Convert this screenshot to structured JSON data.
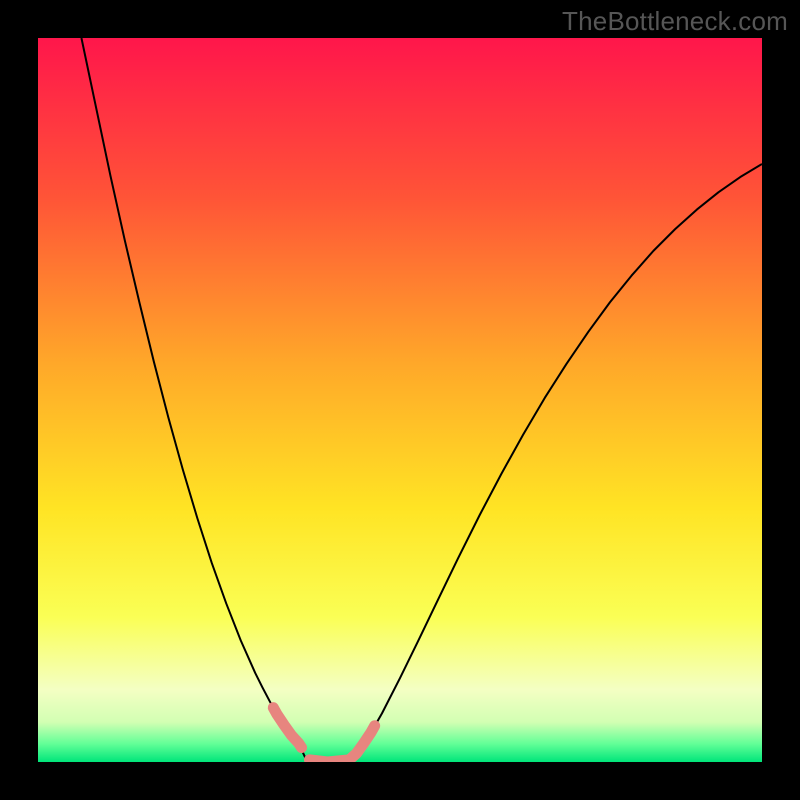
{
  "watermark": "TheBottleneck.com",
  "chart_data": {
    "type": "line",
    "title": "",
    "xlabel": "",
    "ylabel": "",
    "xlim": [
      0,
      100
    ],
    "ylim": [
      0,
      100
    ],
    "gradient_stops": [
      {
        "offset": 0,
        "color": "#ff164b"
      },
      {
        "offset": 0.22,
        "color": "#ff5437"
      },
      {
        "offset": 0.45,
        "color": "#ffa829"
      },
      {
        "offset": 0.65,
        "color": "#ffe424"
      },
      {
        "offset": 0.8,
        "color": "#faff55"
      },
      {
        "offset": 0.9,
        "color": "#f4ffc3"
      },
      {
        "offset": 0.945,
        "color": "#d2ffb3"
      },
      {
        "offset": 0.975,
        "color": "#62ff97"
      },
      {
        "offset": 1.0,
        "color": "#00e57a"
      }
    ],
    "series": [
      {
        "name": "bottleneck-curve",
        "stroke": "#000000",
        "stroke_width": 2.0,
        "points": [
          {
            "x": 6.0,
            "y": 100.0
          },
          {
            "x": 8.0,
            "y": 90.5
          },
          {
            "x": 10.0,
            "y": 81.0
          },
          {
            "x": 12.0,
            "y": 72.0
          },
          {
            "x": 14.0,
            "y": 63.5
          },
          {
            "x": 16.0,
            "y": 55.3
          },
          {
            "x": 18.0,
            "y": 47.6
          },
          {
            "x": 20.0,
            "y": 40.4
          },
          {
            "x": 22.0,
            "y": 33.7
          },
          {
            "x": 24.0,
            "y": 27.5
          },
          {
            "x": 26.0,
            "y": 21.9
          },
          {
            "x": 28.0,
            "y": 16.8
          },
          {
            "x": 30.0,
            "y": 12.3
          },
          {
            "x": 31.0,
            "y": 10.3
          },
          {
            "x": 32.0,
            "y": 8.4
          },
          {
            "x": 33.0,
            "y": 6.6
          },
          {
            "x": 34.0,
            "y": 5.1
          },
          {
            "x": 35.0,
            "y": 3.7
          },
          {
            "x": 36.0,
            "y": 2.6
          },
          {
            "x": 37.0,
            "y": 0.4
          },
          {
            "x": 38.0,
            "y": 0.2
          },
          {
            "x": 40.0,
            "y": 0.0
          },
          {
            "x": 42.0,
            "y": 0.2
          },
          {
            "x": 43.0,
            "y": 0.3
          },
          {
            "x": 44.0,
            "y": 1.2
          },
          {
            "x": 45.0,
            "y": 2.6
          },
          {
            "x": 46.0,
            "y": 4.1
          },
          {
            "x": 47.5,
            "y": 6.7
          },
          {
            "x": 50.0,
            "y": 11.6
          },
          {
            "x": 52.5,
            "y": 16.7
          },
          {
            "x": 55.0,
            "y": 21.9
          },
          {
            "x": 58.0,
            "y": 28.1
          },
          {
            "x": 61.0,
            "y": 34.1
          },
          {
            "x": 64.0,
            "y": 39.8
          },
          {
            "x": 67.0,
            "y": 45.2
          },
          {
            "x": 70.0,
            "y": 50.3
          },
          {
            "x": 73.0,
            "y": 55.0
          },
          {
            "x": 76.0,
            "y": 59.4
          },
          {
            "x": 79.0,
            "y": 63.5
          },
          {
            "x": 82.0,
            "y": 67.2
          },
          {
            "x": 85.0,
            "y": 70.6
          },
          {
            "x": 88.0,
            "y": 73.6
          },
          {
            "x": 91.0,
            "y": 76.3
          },
          {
            "x": 94.0,
            "y": 78.7
          },
          {
            "x": 97.0,
            "y": 80.8
          },
          {
            "x": 100.0,
            "y": 82.6
          }
        ]
      },
      {
        "name": "highlight-segments",
        "stroke": "#e7857f",
        "stroke_width": 11,
        "segments": [
          [
            {
              "x": 32.5,
              "y": 7.5
            },
            {
              "x": 33.0,
              "y": 6.6
            },
            {
              "x": 34.0,
              "y": 5.1
            },
            {
              "x": 35.0,
              "y": 3.7
            },
            {
              "x": 36.0,
              "y": 2.6
            },
            {
              "x": 36.4,
              "y": 2.0
            }
          ],
          [
            {
              "x": 37.5,
              "y": 0.3
            },
            {
              "x": 40.0,
              "y": 0.0
            },
            {
              "x": 43.0,
              "y": 0.3
            },
            {
              "x": 44.0,
              "y": 1.2
            },
            {
              "x": 45.0,
              "y": 2.6
            },
            {
              "x": 46.0,
              "y": 4.1
            },
            {
              "x": 46.5,
              "y": 5.0
            }
          ]
        ]
      }
    ]
  }
}
